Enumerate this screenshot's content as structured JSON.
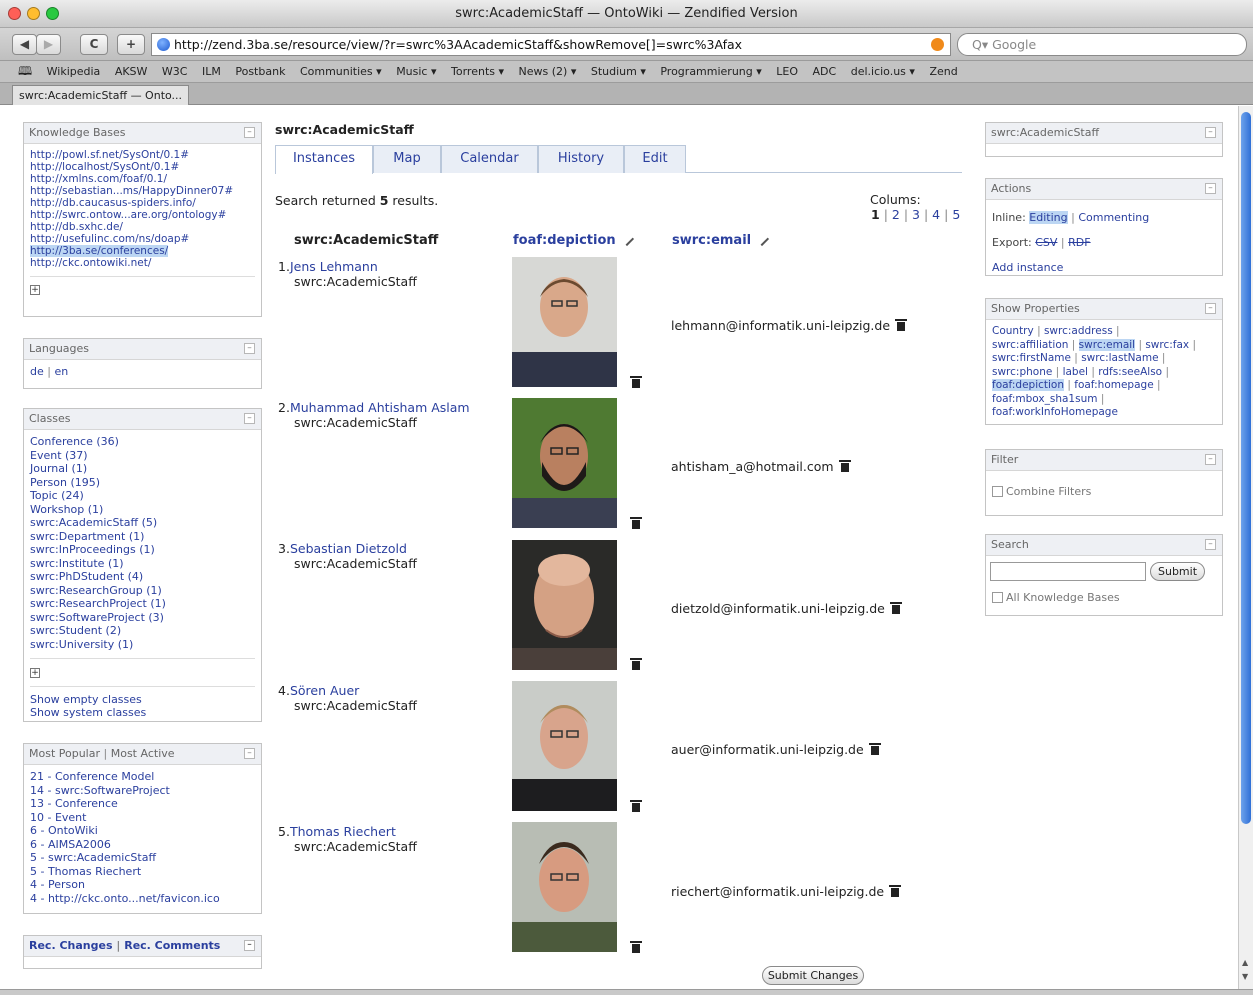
{
  "window": {
    "title": "swrc:AcademicStaff — OntoWiki — Zendified Version"
  },
  "toolbar": {
    "back": "◀",
    "forward": "▶",
    "reload": "C",
    "add": "+",
    "url": "http://zend.3ba.se/resource/view/?r=swrc%3AAcademicStaff&showRemove[]=swrc%3Afax",
    "search_placeholder": "Q▾ Google"
  },
  "bookmarks": [
    "Wikipedia",
    "AKSW",
    "W3C",
    "ILM",
    "Postbank",
    "Communities ▾",
    "Music ▾",
    "Torrents ▾",
    "News (2) ▾",
    "Studium ▾",
    "Programmierung ▾",
    "LEO",
    "ADC",
    "del.icio.us ▾",
    "Zend"
  ],
  "browser_tab": "swrc:AcademicStaff — Onto...",
  "left": {
    "knowledge_bases": {
      "title": "Knowledge Bases",
      "items": [
        "http://powl.sf.net/SysOnt/0.1#",
        "http://localhost/SysOnt/0.1#",
        "http://xmlns.com/foaf/0.1/",
        "http://sebastian...ms/HappyDinner07#",
        "http://db.caucasus-spiders.info/",
        "http://swrc.ontow...are.org/ontology#",
        "http://db.sxhc.de/",
        "http://usefulinc.com/ns/doap#",
        "http://3ba.se/conferences/",
        "http://ckc.ontowiki.net/"
      ],
      "selected": "http://3ba.se/conferences/"
    },
    "languages": {
      "title": "Languages",
      "de": "de",
      "en": "en"
    },
    "classes": {
      "title": "Classes",
      "items": [
        "Conference (36)",
        "Event (37)",
        "Journal (1)",
        "Person (195)",
        "Topic (24)",
        "Workshop (1)",
        "swrc:AcademicStaff (5)",
        "swrc:Department (1)",
        "swrc:InProceedings (1)",
        "swrc:Institute (1)",
        "swrc:PhDStudent (4)",
        "swrc:ResearchGroup (1)",
        "swrc:ResearchProject (1)",
        "swrc:SoftwareProject (3)",
        "swrc:Student (2)",
        "swrc:University (1)"
      ],
      "show_empty": "Show empty classes",
      "show_system": "Show system classes"
    },
    "popular": {
      "tab1": "Most Popular",
      "tab2": "Most Active",
      "items": [
        "21 - Conference Model",
        "14 - swrc:SoftwareProject",
        "13 - Conference",
        "10 - Event",
        "6 - OntoWiki",
        "6 - AIMSA2006",
        "5 - swrc:AcademicStaff",
        "5 - Thomas Riechert",
        "4 - Person",
        "4 - http://ckc.onto...net/favicon.ico"
      ]
    },
    "recent": {
      "tab1": "Rec. Changes",
      "tab2": "Rec. Comments"
    }
  },
  "main": {
    "title": "swrc:AcademicStaff",
    "tabs": [
      "Instances",
      "Map",
      "Calendar",
      "History",
      "Edit"
    ],
    "results_prefix": "Search returned ",
    "results_count": "5",
    "results_suffix": " results.",
    "columns_label": "Colums:",
    "columns": [
      "1",
      "2",
      "3",
      "4",
      "5"
    ],
    "col_headers": {
      "resource": "swrc:AcademicStaff",
      "depiction": "foaf:depiction",
      "email": "swrc:email"
    },
    "instances": [
      {
        "num": "1.",
        "name": "Jens Lehmann",
        "class": "swrc:AcademicStaff",
        "email": "lehmann@informatik.uni-leipzig.de"
      },
      {
        "num": "2.",
        "name": "Muhammad Ahtisham Aslam",
        "class": "swrc:AcademicStaff",
        "email": "ahtisham_a@hotmail.com"
      },
      {
        "num": "3.",
        "name": "Sebastian Dietzold",
        "class": "swrc:AcademicStaff",
        "email": "dietzold@informatik.uni-leipzig.de"
      },
      {
        "num": "4.",
        "name": "Sören Auer",
        "class": "swrc:AcademicStaff",
        "email": "auer@informatik.uni-leipzig.de"
      },
      {
        "num": "5.",
        "name": "Thomas Riechert",
        "class": "swrc:AcademicStaff",
        "email": "riechert@informatik.uni-leipzig.de"
      }
    ],
    "submit_label": "Submit Changes"
  },
  "right": {
    "resource_box": {
      "title": "swrc:AcademicStaff"
    },
    "actions": {
      "title": "Actions",
      "inline_label": "Inline:",
      "inline_editing": "Editing",
      "inline_commenting": "Commenting",
      "export_label": "Export:",
      "export_csv": "CSV",
      "export_rdf": "RDF",
      "add_instance": "Add instance"
    },
    "properties": {
      "title": "Show Properties",
      "items": [
        "Country",
        "swrc:address",
        "swrc:affiliation",
        "swrc:email",
        "swrc:fax",
        "swrc:firstName",
        "swrc:lastName",
        "swrc:phone",
        "label",
        "rdfs:seeAlso",
        "foaf:depiction",
        "foaf:homepage",
        "foaf:mbox_sha1sum",
        "foaf:workInfoHomepage"
      ],
      "selected": [
        "swrc:email",
        "foaf:depiction"
      ]
    },
    "filter": {
      "title": "Filter",
      "combine": "Combine Filters"
    },
    "search": {
      "title": "Search",
      "button": "Submit",
      "all_kb": "All Knowledge Bases"
    }
  },
  "colors": {
    "link": "#2a3f9e",
    "highlight": "#bcd6f3",
    "box_header": "#eef0f4"
  }
}
